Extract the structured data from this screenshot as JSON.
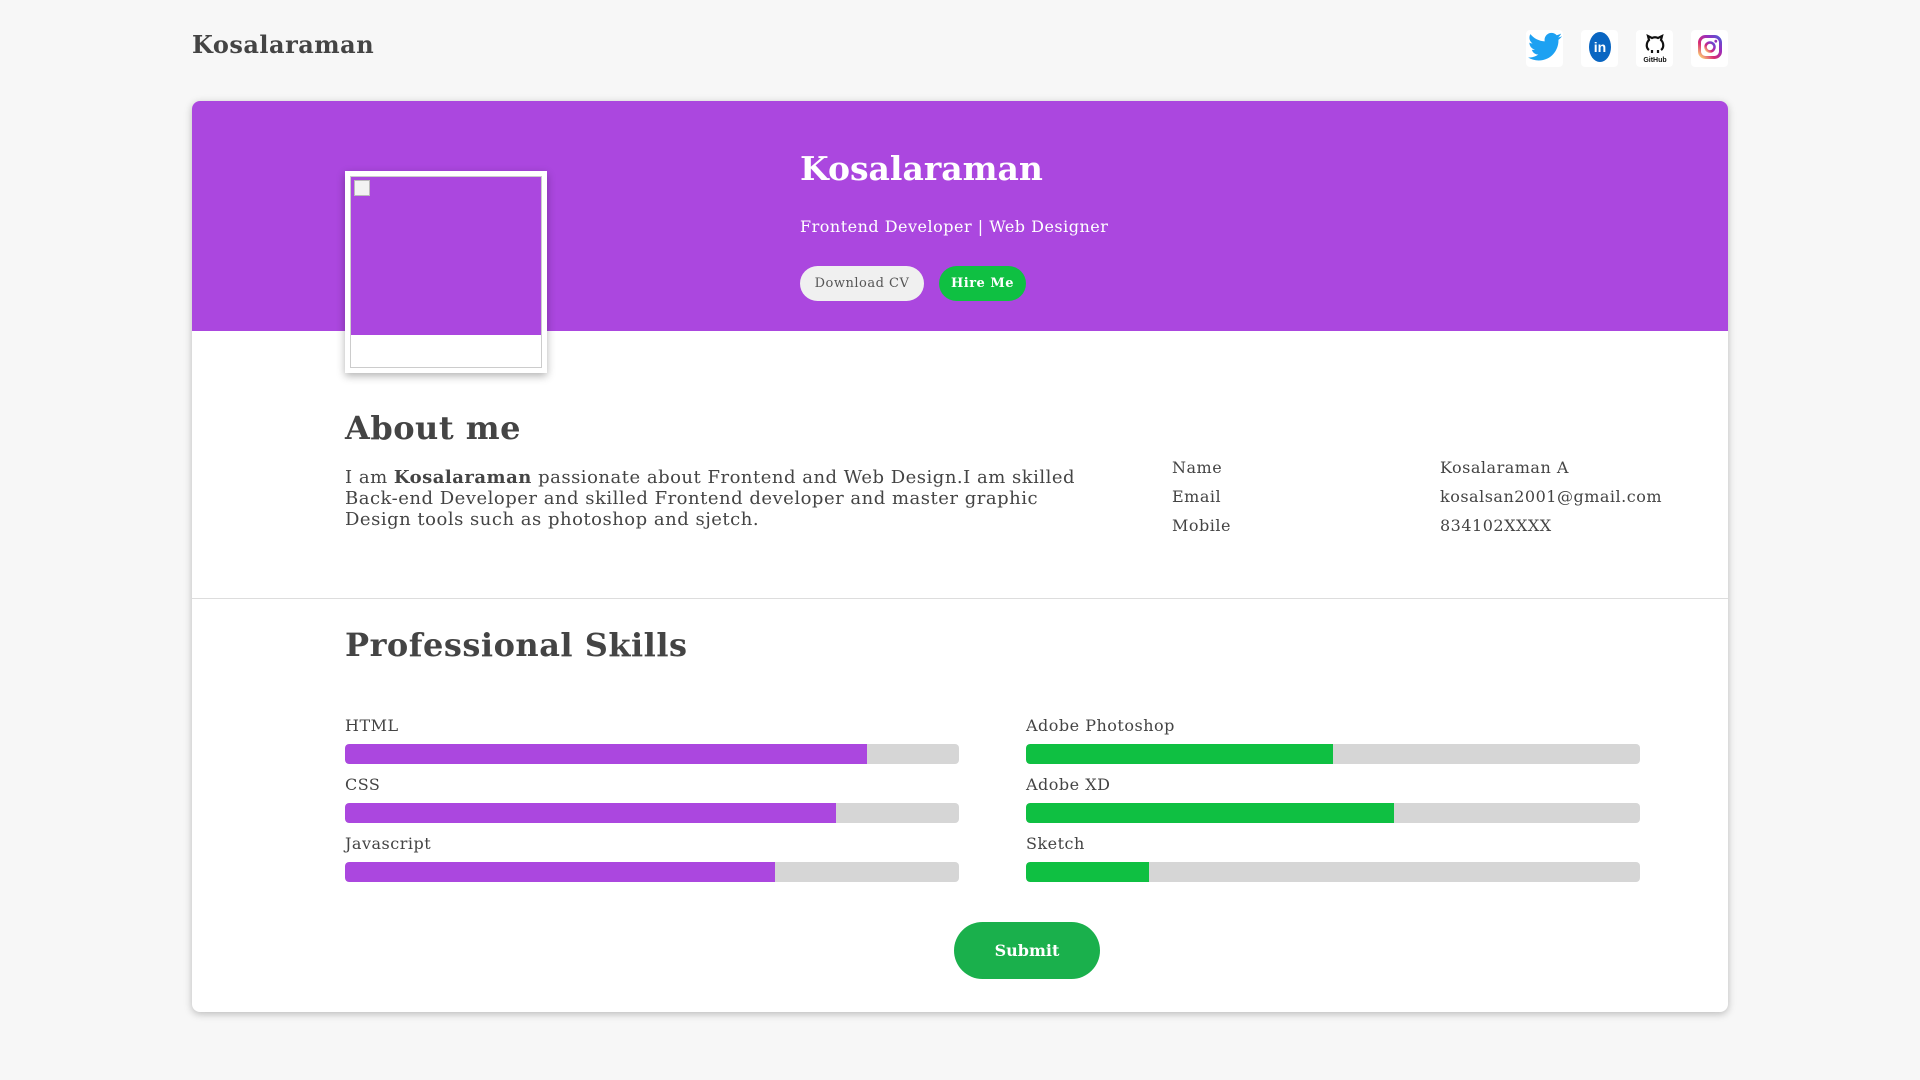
{
  "header": {
    "brand": "Kosalaraman",
    "socials": [
      {
        "icon": "twitter-icon",
        "color": "#1da1f2"
      },
      {
        "icon": "linkedin-icon",
        "color": "#0a66c2"
      },
      {
        "icon": "github-icon",
        "label": "GitHub",
        "color": "#111111"
      },
      {
        "icon": "instagram-icon",
        "color": "#d62976"
      }
    ]
  },
  "hero": {
    "name": "Kosalaraman",
    "role": "Frontend Developer | Web Designer",
    "download_label": "Download CV",
    "hire_label": "Hire Me",
    "accent_color": "#ab47df"
  },
  "about": {
    "title": "About me",
    "text_prefix": "I am ",
    "text_name": "Kosalaraman",
    "text_rest": " passionate about Frontend and Web Design.I am skilled Back-end Developer and skilled Frontend developer and master graphic Design tools such as photoshop and sjetch.",
    "info": [
      {
        "key": "Name",
        "value": "Kosalaraman A"
      },
      {
        "key": "Email",
        "value": "kosalsan2001@gmail.com"
      },
      {
        "key": "Mobile",
        "value": "834102XXXX"
      }
    ]
  },
  "skills": {
    "title": "Professional Skills",
    "left": [
      {
        "name": "HTML",
        "percent": 85
      },
      {
        "name": "CSS",
        "percent": 80
      },
      {
        "name": "Javascript",
        "percent": 70
      }
    ],
    "right": [
      {
        "name": "Adobe Photoshop",
        "percent": 50
      },
      {
        "name": "Adobe XD",
        "percent": 60
      },
      {
        "name": "Sketch",
        "percent": 20
      }
    ],
    "left_color": "#ab47df",
    "right_color": "#0fc042"
  },
  "submit_label": "Submit"
}
